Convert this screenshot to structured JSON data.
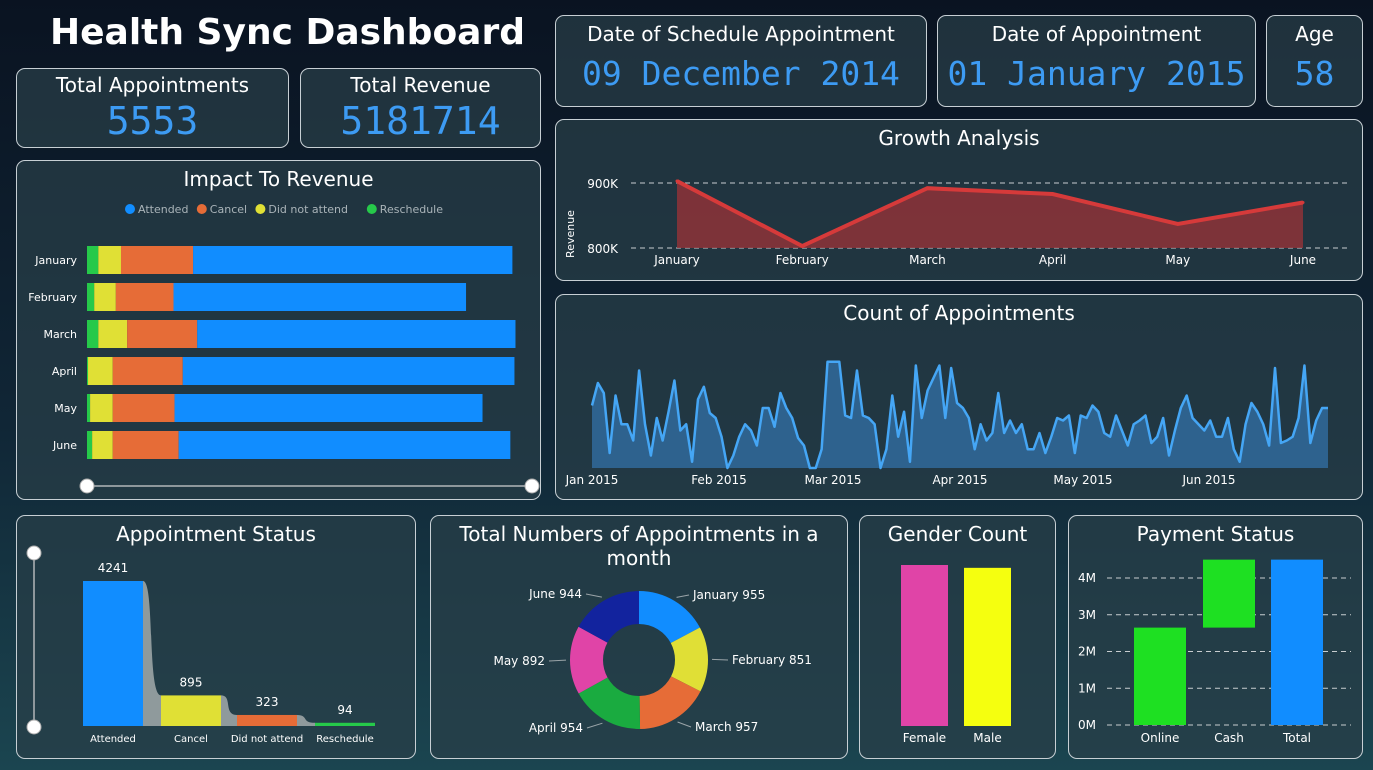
{
  "header": {
    "title": "Health Sync Dashboard"
  },
  "kpis": {
    "total_appointments": {
      "label": "Total Appointments",
      "value": "5553"
    },
    "total_revenue": {
      "label": "Total Revenue",
      "value": "5181714"
    },
    "schedule_date": {
      "label": "Date of Schedule Appointment",
      "value": "09 December 2014"
    },
    "appointment_date": {
      "label": "Date of Appointment",
      "value": "01 January 2015"
    },
    "age": {
      "label": "Age",
      "value": "58"
    }
  },
  "colors": {
    "attended": "#118dff",
    "cancel": "#e66c37",
    "did_not_attend": "#e0e035",
    "reschedule": "#26c94a",
    "growth_line": "#d63a3a",
    "count_line": "#45a6f5"
  },
  "impact": {
    "title": "Impact To Revenue",
    "legend": [
      "Attended",
      "Cancel",
      "Did not attend",
      "Reschedule"
    ]
  },
  "growth": {
    "title": "Growth Analysis"
  },
  "count": {
    "title": "Count of Appointments"
  },
  "status": {
    "title": "Appointment Status"
  },
  "donut": {
    "title": "Total Numbers of Appointments in a month"
  },
  "gender": {
    "title": "Gender Count"
  },
  "payment": {
    "title": "Payment Status"
  },
  "chart_data": [
    {
      "id": "impact",
      "type": "bar",
      "title": "Impact To Revenue",
      "orientation": "horizontal",
      "stacked": true,
      "categories": [
        "January",
        "February",
        "March",
        "April",
        "May",
        "June"
      ],
      "series": [
        {
          "name": "Reschedule",
          "values": [
            11,
            7,
            11,
            1,
            3,
            5
          ]
        },
        {
          "name": "Did not attend",
          "values": [
            22,
            21,
            28,
            24,
            22,
            20
          ]
        },
        {
          "name": "Cancel",
          "values": [
            70,
            56,
            68,
            68,
            60,
            64
          ]
        },
        {
          "name": "Attended",
          "values": [
            310,
            284,
            309,
            322,
            299,
            322
          ]
        }
      ],
      "legend_position": "top-center"
    },
    {
      "id": "growth",
      "type": "area",
      "title": "Growth Analysis",
      "ylabel": "Revenue",
      "x": [
        "January",
        "February",
        "March",
        "April",
        "May",
        "June"
      ],
      "y": [
        903000,
        803000,
        892000,
        883000,
        837000,
        870000
      ],
      "yticks": [
        "800K",
        "900K"
      ],
      "ytick_values": [
        800000,
        900000
      ],
      "ylim": [
        800000,
        920000
      ],
      "grid": true
    },
    {
      "id": "count",
      "type": "area",
      "title": "Count of Appointments",
      "xticks": [
        "Jan 2015",
        "Feb 2015",
        "Mar 2015",
        "Apr 2015",
        "May 2015",
        "Jun 2015"
      ],
      "values": [
        50,
        68,
        60,
        12,
        58,
        35,
        35,
        22,
        78,
        35,
        10,
        40,
        22,
        45,
        70,
        30,
        35,
        5,
        55,
        65,
        44,
        40,
        25,
        0,
        10,
        25,
        35,
        30,
        18,
        48,
        48,
        33,
        60,
        48,
        40,
        24,
        18,
        0,
        0,
        15,
        85,
        85,
        85,
        42,
        40,
        78,
        42,
        40,
        35,
        0,
        15,
        58,
        25,
        45,
        5,
        82,
        40,
        62,
        72,
        82,
        40,
        80,
        52,
        48,
        40,
        15,
        35,
        22,
        28,
        60,
        28,
        38,
        28,
        35,
        15,
        15,
        28,
        12,
        25,
        40,
        38,
        42,
        12,
        42,
        40,
        50,
        45,
        28,
        25,
        42,
        30,
        18,
        35,
        38,
        42,
        20,
        25,
        40,
        10,
        30,
        48,
        58,
        40,
        35,
        30,
        38,
        25,
        25,
        40,
        15,
        5,
        35,
        52,
        45,
        35,
        18,
        80,
        20,
        22,
        25,
        40,
        82,
        20,
        38,
        48,
        48
      ],
      "ylim": [
        0,
        100
      ]
    },
    {
      "id": "status",
      "type": "bar",
      "title": "Appointment Status",
      "categories": [
        "Attended",
        "Cancel",
        "Did not attend",
        "Reschedule"
      ],
      "values": [
        4241,
        895,
        323,
        94
      ],
      "ylim": [
        0,
        4241
      ]
    },
    {
      "id": "donut",
      "type": "pie",
      "title": "Total Numbers of Appointments in a month",
      "categories": [
        "January",
        "February",
        "March",
        "April",
        "May",
        "June"
      ],
      "values": [
        955,
        851,
        957,
        954,
        892,
        944
      ],
      "labels": [
        "January 955",
        "February 851",
        "March 957",
        "April 954",
        "May 892",
        "June 944"
      ],
      "colors": [
        "#118dff",
        "#e0df36",
        "#e66c37",
        "#1aab40",
        "#e044a7",
        "#12239e"
      ]
    },
    {
      "id": "gender",
      "type": "bar",
      "title": "Gender Count",
      "categories": [
        "Female",
        "Male"
      ],
      "values": [
        2840,
        2790
      ],
      "colors": [
        "#e044a7",
        "#f5ff0f"
      ],
      "ylim": [
        0,
        2840
      ]
    },
    {
      "id": "payment",
      "type": "bar",
      "subtype": "waterfall",
      "title": "Payment Status",
      "categories": [
        "Online",
        "Cash",
        "Total"
      ],
      "values": [
        2650000,
        1850000,
        4500000
      ],
      "colors": [
        "#1ee022",
        "#1ee022",
        "#118dff"
      ],
      "yticks": [
        "0M",
        "1M",
        "2M",
        "3M",
        "4M"
      ],
      "ytick_values": [
        0,
        1000000,
        2000000,
        3000000,
        4000000
      ],
      "ylim": [
        0,
        4500000
      ],
      "grid": true
    }
  ]
}
